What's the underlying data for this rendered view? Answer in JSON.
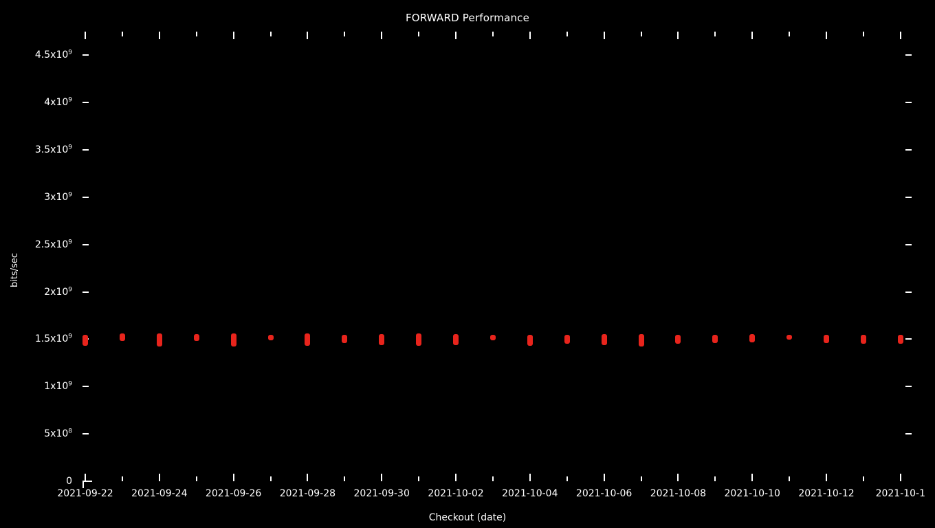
{
  "chart_data": {
    "type": "scatter",
    "title": "FORWARD Performance",
    "xlabel": "Checkout (date)",
    "ylabel": "bits/sec",
    "background_color": "#000000",
    "foreground_color": "#ffffff",
    "marker_color": "#e8241c",
    "grid": false,
    "legend": null,
    "ylim": [
      0,
      4750000000
    ],
    "ytick_labels": [
      {
        "text": "0",
        "sup": "",
        "value": 0
      },
      {
        "text": "5x10",
        "sup": "8",
        "value": 500000000
      },
      {
        "text": "1x10",
        "sup": "9",
        "value": 1000000000
      },
      {
        "text": "1.5x10",
        "sup": "9",
        "value": 1500000000
      },
      {
        "text": "2x10",
        "sup": "9",
        "value": 2000000000
      },
      {
        "text": "2.5x10",
        "sup": "9",
        "value": 2500000000
      },
      {
        "text": "3x10",
        "sup": "9",
        "value": 3000000000
      },
      {
        "text": "3.5x10",
        "sup": "9",
        "value": 3500000000
      },
      {
        "text": "4x10",
        "sup": "9",
        "value": 4000000000
      },
      {
        "text": "4.5x10",
        "sup": "9",
        "value": 4500000000
      }
    ],
    "xtick_labels": [
      "2021-09-22",
      "2021-09-24",
      "2021-09-26",
      "2021-09-28",
      "2021-09-30",
      "2021-10-02",
      "2021-10-04",
      "2021-10-06",
      "2021-10-08",
      "2021-10-10",
      "2021-10-12",
      "2021-10-1"
    ],
    "x": [
      "2021-09-22",
      "2021-09-23",
      "2021-09-24",
      "2021-09-25",
      "2021-09-26",
      "2021-09-27",
      "2021-09-28",
      "2021-09-29",
      "2021-09-30",
      "2021-10-01",
      "2021-10-02",
      "2021-10-03",
      "2021-10-04",
      "2021-10-05",
      "2021-10-06",
      "2021-10-07",
      "2021-10-08",
      "2021-10-09",
      "2021-10-10",
      "2021-10-11",
      "2021-10-12",
      "2021-10-13",
      "2021-10-14"
    ],
    "series": [
      {
        "name": "FORWARD",
        "color": "#e8241c",
        "points": [
          {
            "x": "2021-09-22",
            "y_center": 1490000000,
            "y_low": 1430000000,
            "y_high": 1550000000
          },
          {
            "x": "2021-09-23",
            "y_center": 1520000000,
            "y_low": 1480000000,
            "y_high": 1560000000
          },
          {
            "x": "2021-09-24",
            "y_center": 1490000000,
            "y_low": 1420000000,
            "y_high": 1560000000
          },
          {
            "x": "2021-09-25",
            "y_center": 1515000000,
            "y_low": 1480000000,
            "y_high": 1555000000
          },
          {
            "x": "2021-09-26",
            "y_center": 1490000000,
            "y_low": 1420000000,
            "y_high": 1565000000
          },
          {
            "x": "2021-09-27",
            "y_center": 1520000000,
            "y_low": 1490000000,
            "y_high": 1550000000
          },
          {
            "x": "2021-09-28",
            "y_center": 1495000000,
            "y_low": 1430000000,
            "y_high": 1560000000
          },
          {
            "x": "2021-09-29",
            "y_center": 1505000000,
            "y_low": 1460000000,
            "y_high": 1550000000
          },
          {
            "x": "2021-09-30",
            "y_center": 1500000000,
            "y_low": 1440000000,
            "y_high": 1555000000
          },
          {
            "x": "2021-10-01",
            "y_center": 1495000000,
            "y_low": 1430000000,
            "y_high": 1560000000
          },
          {
            "x": "2021-10-02",
            "y_center": 1495000000,
            "y_low": 1435000000,
            "y_high": 1555000000
          },
          {
            "x": "2021-10-03",
            "y_center": 1520000000,
            "y_low": 1490000000,
            "y_high": 1550000000
          },
          {
            "x": "2021-10-04",
            "y_center": 1490000000,
            "y_low": 1430000000,
            "y_high": 1550000000
          },
          {
            "x": "2021-10-05",
            "y_center": 1500000000,
            "y_low": 1450000000,
            "y_high": 1550000000
          },
          {
            "x": "2021-10-06",
            "y_center": 1498000000,
            "y_low": 1440000000,
            "y_high": 1555000000
          },
          {
            "x": "2021-10-07",
            "y_center": 1490000000,
            "y_low": 1425000000,
            "y_high": 1555000000
          },
          {
            "x": "2021-10-08",
            "y_center": 1500000000,
            "y_low": 1450000000,
            "y_high": 1550000000
          },
          {
            "x": "2021-10-09",
            "y_center": 1505000000,
            "y_low": 1460000000,
            "y_high": 1550000000
          },
          {
            "x": "2021-10-10",
            "y_center": 1510000000,
            "y_low": 1465000000,
            "y_high": 1555000000
          },
          {
            "x": "2021-10-11",
            "y_center": 1520000000,
            "y_low": 1495000000,
            "y_high": 1545000000
          },
          {
            "x": "2021-10-12",
            "y_center": 1505000000,
            "y_low": 1460000000,
            "y_high": 1550000000
          },
          {
            "x": "2021-10-13",
            "y_center": 1500000000,
            "y_low": 1450000000,
            "y_high": 1550000000
          },
          {
            "x": "2021-10-14",
            "y_center": 1500000000,
            "y_low": 1455000000,
            "y_high": 1545000000
          }
        ]
      }
    ]
  }
}
